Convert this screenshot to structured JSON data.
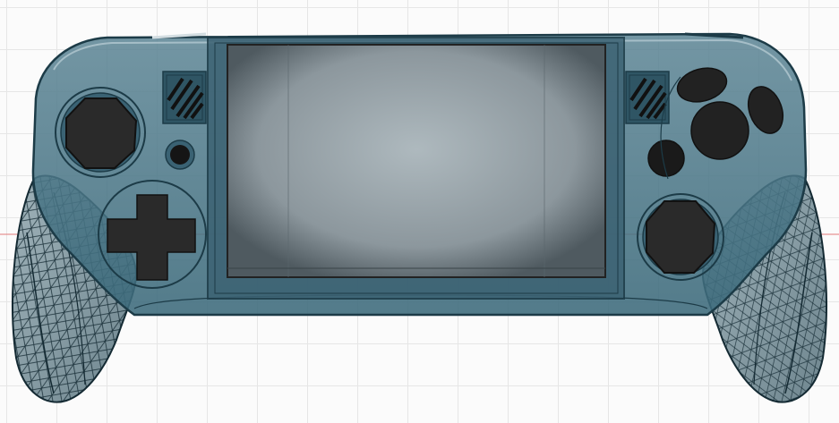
{
  "scene": {
    "description_hidden": "",
    "colors": {
      "background": "#fbfbfb",
      "grid": "#e6e6e6",
      "axis_line": "#e07a7a",
      "shell_fill": "#3f6e80",
      "shell_edge": "#1c3b47",
      "screen_center": "#a9b4b9",
      "screen_edge": "#5e6a70",
      "button_fill": "#222222",
      "wireframe": "#142a33",
      "grip_fill": "#8aa0a8"
    },
    "icons": {
      "left_stick": "octagon-stick-icon",
      "right_stick": "octagon-stick-icon",
      "dpad": "dpad-icon",
      "speaker_left": "speaker-grille-icon",
      "speaker_right": "speaker-grille-icon",
      "face_buttons": "face-buttons-icon"
    }
  }
}
